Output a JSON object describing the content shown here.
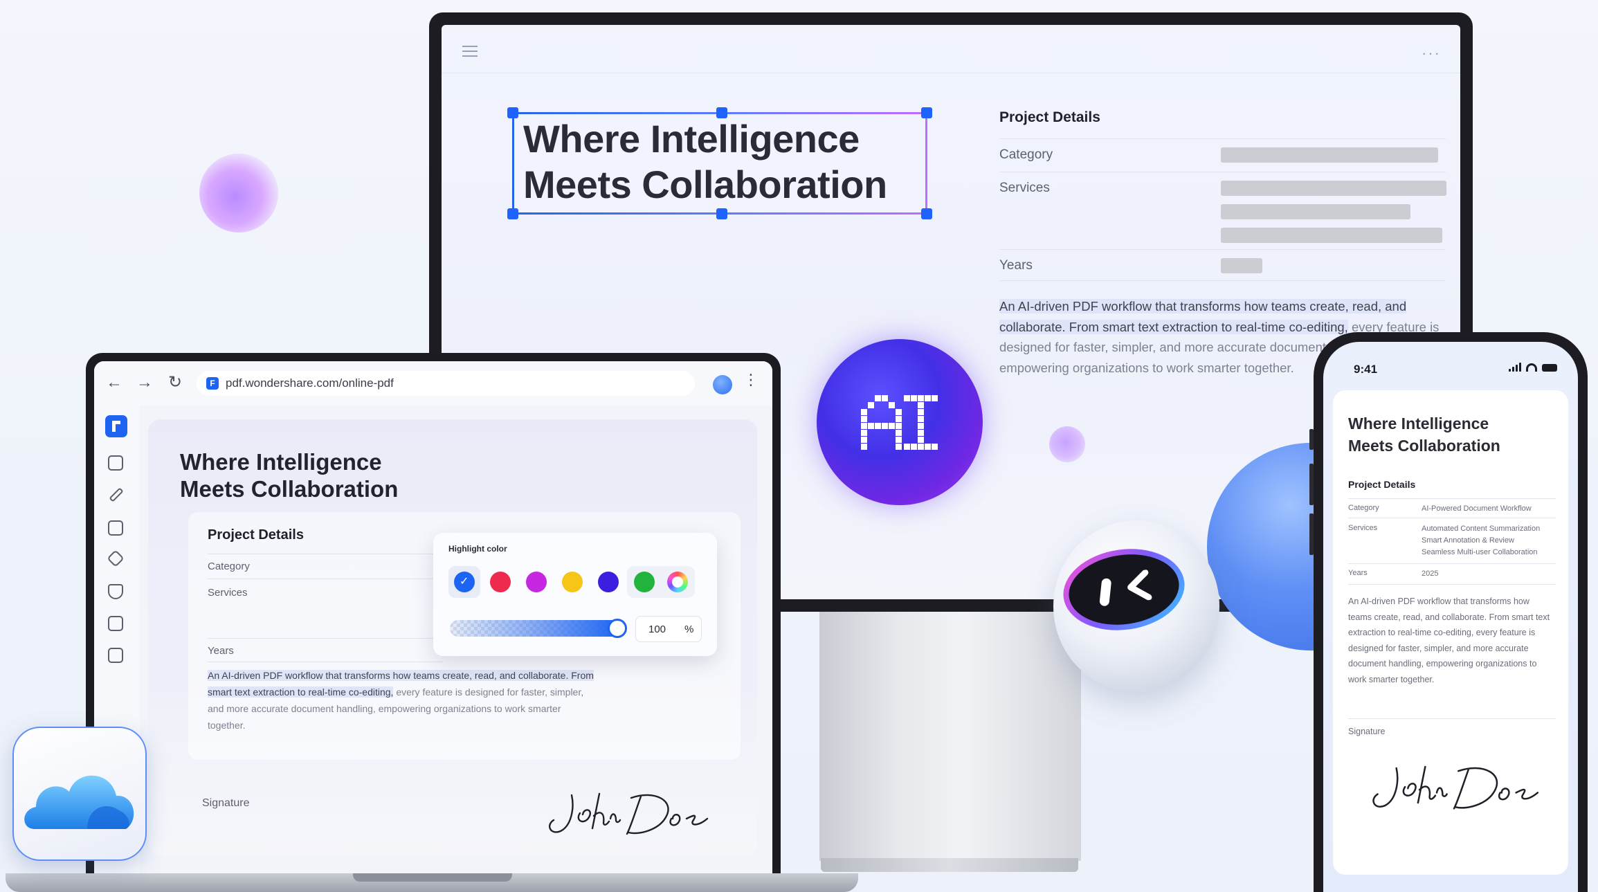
{
  "monitor": {
    "title_line1": "Where Intelligence",
    "title_line2": "Meets Collaboration",
    "details_heading": "Project Details",
    "category_label": "Category",
    "services_label": "Services",
    "years_label": "Years",
    "paragraph_highlighted": "An AI-driven PDF workflow that transforms how teams create, read, and collaborate. From smart text extraction to real-time co-editing,",
    "paragraph_rest": " every feature is designed for faster, simpler, and more accurate document handling, empowering organizations to work smarter together.",
    "menu_icon": "hamburger-icon",
    "more_icon": "ellipsis-icon"
  },
  "ai_badge": {
    "label": "AI",
    "colors": [
      "#4230e6",
      "#9d3cf0"
    ]
  },
  "browser": {
    "url": "pdf.wondershare.com/online-pdf",
    "favicon_label": "F",
    "back_icon": "←",
    "forward_icon": "→",
    "reload_icon": "↻",
    "kebab_icon": "⋮"
  },
  "laptop_doc": {
    "title_line1": "Where Intelligence",
    "title_line2": "Meets Collaboration",
    "details_heading": "Project Details",
    "category_label": "Category",
    "services_label": "Services",
    "years_label": "Years",
    "paragraph_highlighted": "An AI-driven PDF workflow that transforms how teams create, read, and collaborate. From smart text extraction to real-time co-editing,",
    "paragraph_rest": " every feature is designed for faster, simpler, and more accurate document handling, empowering organizations to work smarter together.",
    "signature_label": "Signature"
  },
  "sidebar_icons": [
    "translate-icon",
    "edit-icon",
    "copy-icon",
    "layers-icon",
    "shield-icon",
    "camera-icon",
    "file-icon"
  ],
  "highlight_panel": {
    "title": "Highlight color",
    "swatches": [
      "#1d64f2",
      "#ee2a4f",
      "#c528e0",
      "#f5c518",
      "#3a1fe0",
      "#21b33b"
    ],
    "selected_index": 0,
    "opacity_value": "100",
    "opacity_unit": "%",
    "opacity_fraction": 1.0
  },
  "phone": {
    "time": "9:41",
    "title_line1": "Where Intelligence",
    "title_line2": "Meets Collaboration",
    "details_heading": "Project Details",
    "category_label": "Category",
    "category_value": "AI-Powered Document Workflow",
    "services_label": "Services",
    "services_value_1": "Automated Content Summarization",
    "services_value_2": "Smart Annotation & Review",
    "services_value_3": "Seamless Multi-user Collaboration",
    "years_label": "Years",
    "years_value": "2025",
    "paragraph": "An AI-driven PDF workflow that transforms how teams create, read, and collaborate. From smart text extraction to real-time co-editing, every feature is designed for faster, simpler, and more accurate document handling, empowering organizations to work smarter together.",
    "signature_label": "Signature"
  },
  "signature_text": "John Doe",
  "accent_color": "#1d64f2"
}
